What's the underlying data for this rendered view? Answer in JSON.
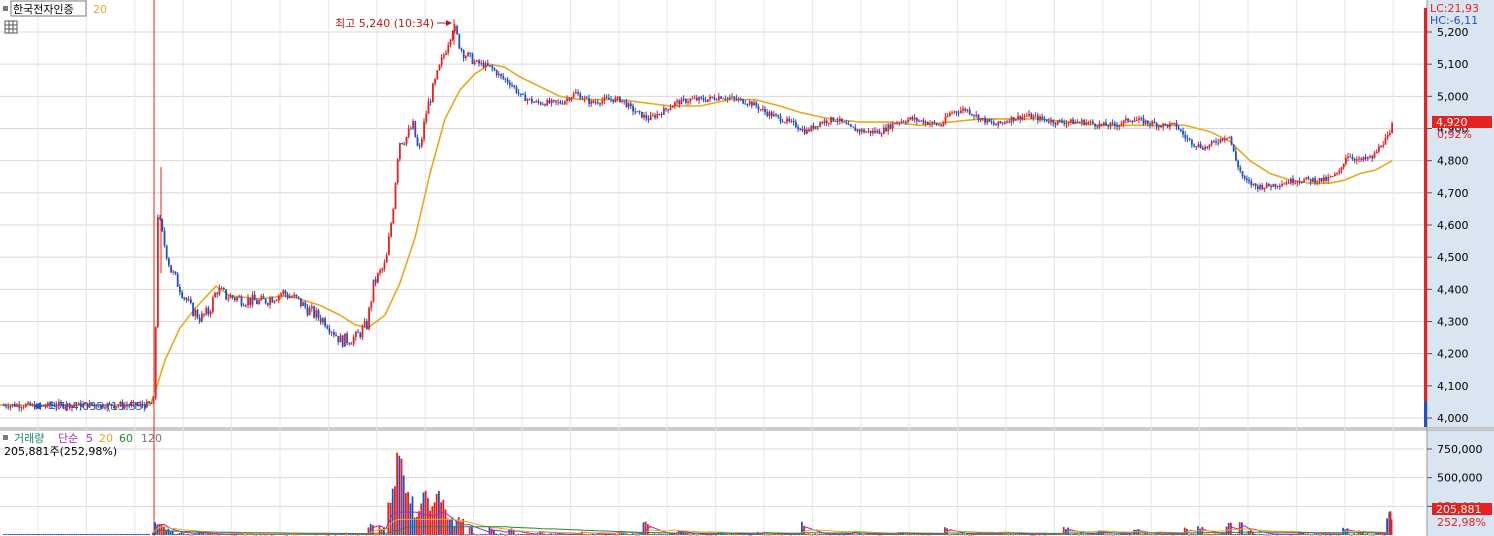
{
  "header": {
    "stock_name": "한국전자인증",
    "ma_label": "20"
  },
  "volume_header": {
    "label": "거래량",
    "ma_type": "단순",
    "ma_periods": [
      "5",
      "20",
      "60",
      "120"
    ],
    "current": "205,881주(252,98%)"
  },
  "price_axis": {
    "ticks": [
      "5,200",
      "5,100",
      "5,000",
      "4,900",
      "4,800",
      "4,700",
      "4,600",
      "4,500",
      "4,400",
      "4,300",
      "4,200",
      "4,100",
      "4,000"
    ],
    "lc": "LC:21,93",
    "hc": "HC:-6,11",
    "current_price": "4,920",
    "current_change": "0,92%"
  },
  "volume_axis": {
    "ticks": [
      "750,000",
      "500,000",
      "250,000"
    ],
    "current_volume": "205,881",
    "current_pct": "252,98%"
  },
  "annotations": {
    "high": "최고 5,240 (10:34)",
    "low": "최저 4,035 (13:55)"
  },
  "colors": {
    "up": "#e8201e",
    "down": "#1f50c8",
    "ma20": "#e8a91e",
    "ma5_vol": "#a030c0",
    "ma20_vol": "#e8a91e",
    "ma60_vol": "#1e8a3a",
    "grid": "#d8d8d8"
  },
  "chart_data": {
    "type": "candlestick",
    "price_range": [
      3970,
      5240
    ],
    "volume_range": [
      0,
      900000
    ],
    "high": 5240,
    "low": 4035,
    "last": 4920,
    "volume_last": 205881,
    "price_path": [
      [
        0,
        4040
      ],
      [
        25,
        4040
      ],
      [
        37,
        4035
      ],
      [
        50,
        4040
      ],
      [
        70,
        4040
      ],
      [
        100,
        4040
      ],
      [
        140,
        4040
      ],
      [
        154,
        4045
      ],
      [
        156,
        4650
      ],
      [
        162,
        4560
      ],
      [
        170,
        4460
      ],
      [
        180,
        4400
      ],
      [
        190,
        4340
      ],
      [
        200,
        4310
      ],
      [
        208,
        4330
      ],
      [
        216,
        4400
      ],
      [
        225,
        4380
      ],
      [
        240,
        4370
      ],
      [
        260,
        4360
      ],
      [
        282,
        4390
      ],
      [
        295,
        4370
      ],
      [
        310,
        4330
      ],
      [
        325,
        4300
      ],
      [
        340,
        4240
      ],
      [
        355,
        4250
      ],
      [
        366,
        4290
      ],
      [
        373,
        4420
      ],
      [
        385,
        4480
      ],
      [
        392,
        4650
      ],
      [
        398,
        4860
      ],
      [
        405,
        4870
      ],
      [
        412,
        4910
      ],
      [
        418,
        4820
      ],
      [
        426,
        4960
      ],
      [
        434,
        5040
      ],
      [
        442,
        5120
      ],
      [
        452,
        5220
      ],
      [
        460,
        5150
      ],
      [
        470,
        5110
      ],
      [
        480,
        5100
      ],
      [
        490,
        5090
      ],
      [
        500,
        5060
      ],
      [
        510,
        5040
      ],
      [
        520,
        5000
      ],
      [
        535,
        4980
      ],
      [
        548,
        4980
      ],
      [
        560,
        4980
      ],
      [
        575,
        5010
      ],
      [
        590,
        4980
      ],
      [
        605,
        4990
      ],
      [
        620,
        4990
      ],
      [
        635,
        4950
      ],
      [
        648,
        4930
      ],
      [
        660,
        4950
      ],
      [
        675,
        4980
      ],
      [
        690,
        4990
      ],
      [
        705,
        4990
      ],
      [
        720,
        5000
      ],
      [
        735,
        4990
      ],
      [
        750,
        4980
      ],
      [
        765,
        4950
      ],
      [
        780,
        4930
      ],
      [
        795,
        4910
      ],
      [
        805,
        4890
      ],
      [
        820,
        4920
      ],
      [
        835,
        4930
      ],
      [
        850,
        4900
      ],
      [
        865,
        4890
      ],
      [
        880,
        4890
      ],
      [
        895,
        4920
      ],
      [
        910,
        4930
      ],
      [
        925,
        4920
      ],
      [
        940,
        4910
      ],
      [
        950,
        4950
      ],
      [
        965,
        4960
      ],
      [
        980,
        4930
      ],
      [
        995,
        4910
      ],
      [
        1010,
        4930
      ],
      [
        1025,
        4940
      ],
      [
        1040,
        4930
      ],
      [
        1055,
        4920
      ],
      [
        1070,
        4920
      ],
      [
        1085,
        4920
      ],
      [
        1100,
        4910
      ],
      [
        1115,
        4910
      ],
      [
        1130,
        4930
      ],
      [
        1145,
        4920
      ],
      [
        1160,
        4910
      ],
      [
        1175,
        4910
      ],
      [
        1185,
        4870
      ],
      [
        1195,
        4850
      ],
      [
        1205,
        4840
      ],
      [
        1215,
        4860
      ],
      [
        1228,
        4880
      ],
      [
        1235,
        4800
      ],
      [
        1243,
        4740
      ],
      [
        1255,
        4720
      ],
      [
        1265,
        4720
      ],
      [
        1280,
        4730
      ],
      [
        1295,
        4740
      ],
      [
        1310,
        4740
      ],
      [
        1325,
        4740
      ],
      [
        1338,
        4760
      ],
      [
        1346,
        4820
      ],
      [
        1358,
        4800
      ],
      [
        1372,
        4810
      ],
      [
        1380,
        4850
      ],
      [
        1389,
        4880
      ],
      [
        1392,
        4920
      ]
    ],
    "ma20_path": [
      [
        0,
        4040
      ],
      [
        150,
        4040
      ],
      [
        156,
        4090
      ],
      [
        165,
        4180
      ],
      [
        180,
        4280
      ],
      [
        195,
        4340
      ],
      [
        210,
        4390
      ],
      [
        216,
        4410
      ],
      [
        230,
        4380
      ],
      [
        260,
        4370
      ],
      [
        285,
        4380
      ],
      [
        300,
        4370
      ],
      [
        320,
        4350
      ],
      [
        340,
        4320
      ],
      [
        355,
        4290
      ],
      [
        368,
        4280
      ],
      [
        385,
        4320
      ],
      [
        400,
        4420
      ],
      [
        415,
        4560
      ],
      [
        430,
        4760
      ],
      [
        445,
        4930
      ],
      [
        460,
        5020
      ],
      [
        475,
        5070
      ],
      [
        490,
        5100
      ],
      [
        505,
        5090
      ],
      [
        520,
        5060
      ],
      [
        540,
        5030
      ],
      [
        560,
        5000
      ],
      [
        580,
        4990
      ],
      [
        600,
        4990
      ],
      [
        620,
        4990
      ],
      [
        645,
        4980
      ],
      [
        670,
        4970
      ],
      [
        700,
        4970
      ],
      [
        730,
        4990
      ],
      [
        755,
        4990
      ],
      [
        780,
        4970
      ],
      [
        800,
        4950
      ],
      [
        830,
        4930
      ],
      [
        860,
        4920
      ],
      [
        890,
        4920
      ],
      [
        920,
        4910
      ],
      [
        950,
        4920
      ],
      [
        980,
        4930
      ],
      [
        1010,
        4930
      ],
      [
        1040,
        4930
      ],
      [
        1070,
        4920
      ],
      [
        1100,
        4910
      ],
      [
        1130,
        4910
      ],
      [
        1160,
        4910
      ],
      [
        1185,
        4910
      ],
      [
        1210,
        4890
      ],
      [
        1230,
        4860
      ],
      [
        1250,
        4800
      ],
      [
        1270,
        4760
      ],
      [
        1290,
        4740
      ],
      [
        1310,
        4730
      ],
      [
        1330,
        4730
      ],
      [
        1345,
        4740
      ],
      [
        1360,
        4760
      ],
      [
        1375,
        4770
      ],
      [
        1392,
        4800
      ]
    ],
    "volume_peaks": [
      [
        156,
        140000
      ],
      [
        160,
        100000
      ],
      [
        165,
        70000
      ],
      [
        170,
        40000
      ],
      [
        180,
        25000
      ],
      [
        200,
        20000
      ],
      [
        240,
        12000
      ],
      [
        290,
        10000
      ],
      [
        340,
        15000
      ],
      [
        370,
        120000
      ],
      [
        380,
        80000
      ],
      [
        390,
        500000
      ],
      [
        395,
        720000
      ],
      [
        400,
        800000
      ],
      [
        405,
        600000
      ],
      [
        410,
        400000
      ],
      [
        415,
        180000
      ],
      [
        420,
        300000
      ],
      [
        425,
        480000
      ],
      [
        430,
        380000
      ],
      [
        435,
        400000
      ],
      [
        440,
        350000
      ],
      [
        445,
        250000
      ],
      [
        450,
        220000
      ],
      [
        455,
        130000
      ],
      [
        460,
        200000
      ],
      [
        470,
        120000
      ],
      [
        490,
        80000
      ],
      [
        510,
        60000
      ],
      [
        540,
        40000
      ],
      [
        580,
        30000
      ],
      [
        620,
        40000
      ],
      [
        645,
        140000
      ],
      [
        680,
        40000
      ],
      [
        720,
        30000
      ],
      [
        760,
        30000
      ],
      [
        802,
        120000
      ],
      [
        850,
        30000
      ],
      [
        900,
        30000
      ],
      [
        945,
        80000
      ],
      [
        1000,
        30000
      ],
      [
        1065,
        80000
      ],
      [
        1100,
        40000
      ],
      [
        1135,
        60000
      ],
      [
        1185,
        70000
      ],
      [
        1200,
        80000
      ],
      [
        1228,
        120000
      ],
      [
        1240,
        130000
      ],
      [
        1250,
        50000
      ],
      [
        1300,
        30000
      ],
      [
        1345,
        70000
      ],
      [
        1360,
        40000
      ],
      [
        1389,
        205881
      ]
    ]
  }
}
